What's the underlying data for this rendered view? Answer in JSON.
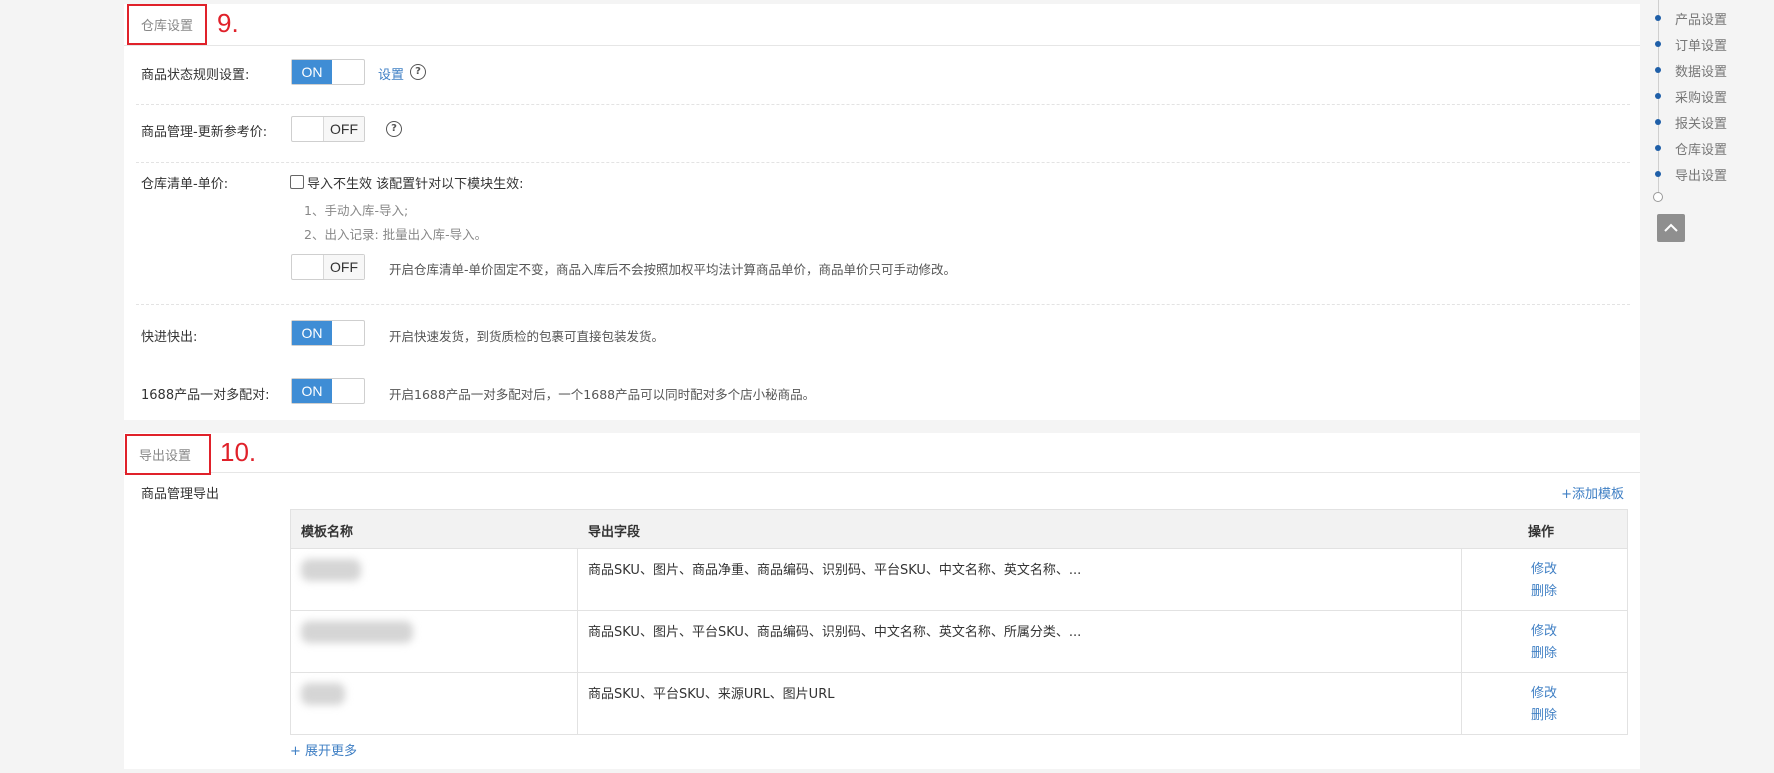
{
  "warehouse": {
    "tab": "仓库设置",
    "anno": "9.",
    "rows": {
      "status_rule": {
        "label": "商品状态规则设置:",
        "toggle": "ON",
        "link": "设置"
      },
      "ref_price": {
        "label": "商品管理-更新参考价:",
        "toggle": "OFF"
      },
      "unit_price": {
        "label": "仓库清单-单价:",
        "checkbox_label": "导入不生效 该配置针对以下模块生效:",
        "note1": "1、手动入库-导入;",
        "note2": "2、出入记录: 批量出入库-导入。",
        "toggle": "OFF",
        "desc": "开启仓库清单-单价固定不变，商品入库后不会按照加权平均法计算商品单价，商品单价只可手动修改。"
      },
      "fast": {
        "label": "快进快出:",
        "toggle": "ON",
        "desc": "开启快速发货，到货质检的包裹可直接包装发货。"
      },
      "match1688": {
        "label": "1688产品一对多配对:",
        "toggle": "ON",
        "desc": "开启1688产品一对多配对后，一个1688产品可以同时配对多个店小秘商品。"
      }
    }
  },
  "export": {
    "tab": "导出设置",
    "anno": "10.",
    "section_title": "商品管理导出",
    "add_template": "+添加模板",
    "table": {
      "headers": {
        "name": "模板名称",
        "fields": "导出字段",
        "ops": "操作"
      },
      "rows": [
        {
          "fields": "商品SKU、图片、商品净重、商品编码、识别码、平台SKU、中文名称、英文名称、...",
          "edit": "修改",
          "delete": "删除"
        },
        {
          "fields": "商品SKU、图片、平台SKU、商品编码、识别码、中文名称、英文名称、所属分类、...",
          "edit": "修改",
          "delete": "删除"
        },
        {
          "fields": "商品SKU、平台SKU、来源URL、图片URL",
          "edit": "修改",
          "delete": "删除"
        }
      ]
    },
    "expand_more": "+ 展开更多"
  },
  "nav": {
    "items": [
      {
        "label": "产品设置"
      },
      {
        "label": "订单设置"
      },
      {
        "label": "数据设置"
      },
      {
        "label": "采购设置"
      },
      {
        "label": "报关设置"
      },
      {
        "label": "仓库设置"
      },
      {
        "label": "导出设置"
      }
    ]
  },
  "colors": {
    "accent": "#3f8dd5",
    "annotation": "#e0212a",
    "link": "#3f7fc4"
  },
  "icons": [
    "help-icon",
    "chevron-up-icon"
  ]
}
